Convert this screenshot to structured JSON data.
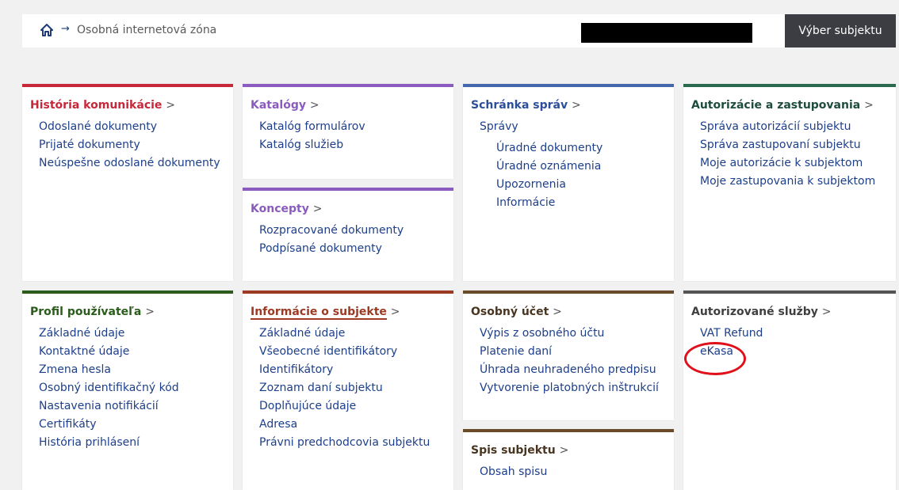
{
  "header": {
    "breadcrumb": "Osobná internetová zóna",
    "select_button": "Výber subjektu"
  },
  "cards": {
    "historia": {
      "title": "História komunikácie",
      "items": [
        "Odoslané dokumenty",
        "Prijaté dokumenty",
        "Neúspešne odoslané dokumenty"
      ]
    },
    "katalogy": {
      "title": "Katalógy",
      "items": [
        "Katalóg formulárov",
        "Katalóg služieb"
      ]
    },
    "koncepty": {
      "title": "Koncepty",
      "items": [
        "Rozpracované dokumenty",
        "Podpísané dokumenty"
      ]
    },
    "schranka": {
      "title": "Schránka správ",
      "section": "Správy",
      "items": [
        "Úradné dokumenty",
        "Úradné oznámenia",
        "Upozornenia",
        "Informácie"
      ]
    },
    "autorizacie": {
      "title": "Autorizácie a zastupovania",
      "items": [
        "Správa autorizácií subjektu",
        "Správa zastupovaní subjektu",
        "Moje autorizácie k subjektom",
        "Moje zastupovania k subjektom"
      ]
    },
    "profil": {
      "title": "Profil používateľa",
      "items": [
        "Základné údaje",
        "Kontaktné údaje",
        "Zmena hesla",
        "Osobný identifikačný kód",
        "Nastavenia notifikácií",
        "Certifikáty",
        "História prihlásení"
      ]
    },
    "informacie": {
      "title": "Informácie o subjekte",
      "items": [
        "Základné údaje",
        "Všeobecné identifikátory",
        "Identifikátory",
        "Zoznam daní subjektu",
        "Doplňujúce údaje",
        "Adresa",
        "Právni predchodcovia subjektu"
      ]
    },
    "ucet": {
      "title": "Osobný účet",
      "items": [
        "Výpis z osobného účtu",
        "Platenie daní",
        "Úhrada neuhradeného predpisu",
        "Vytvorenie platobných inštrukcií"
      ]
    },
    "spis": {
      "title": "Spis subjektu",
      "items": [
        "Obsah spisu"
      ]
    },
    "sluzby": {
      "title": "Autorizované služby",
      "items": [
        "VAT Refund",
        "eKasa"
      ]
    }
  },
  "gt": ">",
  "arrow": "→"
}
